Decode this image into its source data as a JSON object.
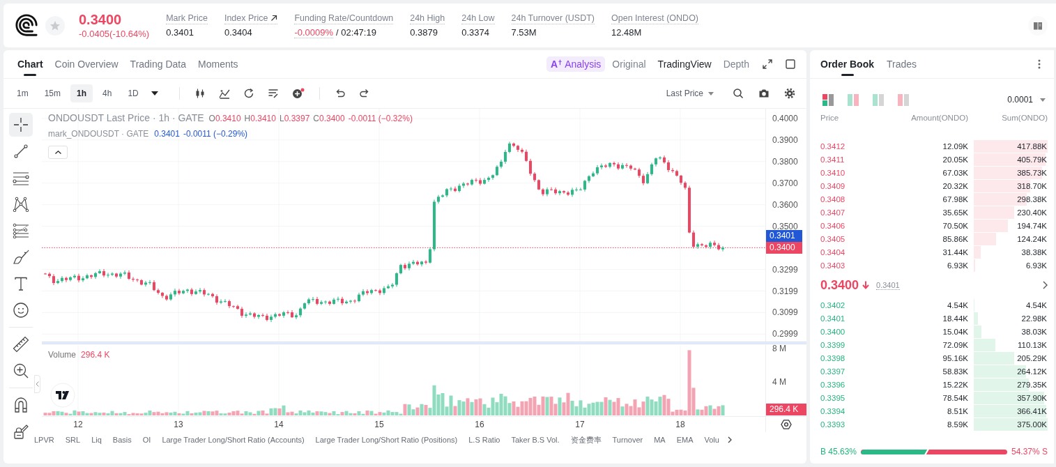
{
  "header": {
    "favorited": false,
    "price": "0.3400",
    "change": "-0.0405(-10.64%)",
    "stats": [
      {
        "kind": "plain",
        "label": "Mark Price",
        "value": "0.3401"
      },
      {
        "kind": "link",
        "label": "Index Price",
        "value": "0.3404"
      },
      {
        "kind": "funding",
        "label": "Funding Rate/Countdown",
        "value": "-0.0009%",
        "countdown": "/ 02:47:19"
      },
      {
        "kind": "plain",
        "label": "24h High",
        "value": "0.3879"
      },
      {
        "kind": "plain",
        "label": "24h Low",
        "value": "0.3374"
      },
      {
        "kind": "plain",
        "label": "24h Turnover (USDT)",
        "value": "7.53M"
      },
      {
        "kind": "plain",
        "label": "Open Interest (ONDO)",
        "value": "12.48M"
      }
    ]
  },
  "chart_panel": {
    "tabs": [
      {
        "label": "Chart",
        "selected": true
      },
      {
        "label": "Coin Overview",
        "selected": false
      },
      {
        "label": "Trading Data",
        "selected": false
      },
      {
        "label": "Moments",
        "selected": false
      }
    ],
    "views": [
      {
        "kind": "ai",
        "badge": "A",
        "label": "Analysis",
        "selected": false
      },
      {
        "kind": "text",
        "label": "Original",
        "selected": false
      },
      {
        "kind": "text",
        "label": "TradingView",
        "selected": true
      },
      {
        "kind": "text",
        "label": "Depth",
        "selected": false
      }
    ],
    "intervals": [
      {
        "label": "1m",
        "selected": false
      },
      {
        "label": "15m",
        "selected": false
      },
      {
        "label": "1h",
        "selected": true
      },
      {
        "label": "4h",
        "selected": false
      },
      {
        "label": "1D",
        "selected": false
      }
    ],
    "price_source": "Last Price",
    "tool_groups": [
      [
        {
          "kind": "crosshair",
          "selected": true
        },
        {
          "kind": "trend_line",
          "selected": false
        },
        {
          "kind": "horizontal_lines",
          "selected": false
        },
        {
          "kind": "pattern",
          "selected": false
        },
        {
          "kind": "fib_lines",
          "selected": false
        },
        {
          "kind": "brush",
          "selected": false
        },
        {
          "kind": "text",
          "selected": false
        },
        {
          "kind": "emoji",
          "selected": false
        }
      ],
      [
        {
          "kind": "ruler",
          "selected": false
        },
        {
          "kind": "zoom_in",
          "selected": false
        }
      ],
      [
        {
          "kind": "magnet",
          "selected": false
        },
        {
          "kind": "lock",
          "selected": false
        }
      ]
    ],
    "legend": {
      "title": "ONDOUSDT Last Price · 1h · GATE",
      "ohlc": [
        {
          "label": "O",
          "value": "0.3410"
        },
        {
          "label": "H",
          "value": "0.3410"
        },
        {
          "label": "L",
          "value": "0.3397"
        },
        {
          "label": "C",
          "value": "0.3400"
        }
      ],
      "change": "-0.0011 (−0.32%)"
    },
    "mark_legend": {
      "title": "mark_ONDOUSDT · GATE",
      "value": "0.3401",
      "change": "-0.0011 (−0.29%)"
    },
    "price_axis": [
      "0.4000",
      "0.3900",
      "0.3800",
      "0.3700",
      "0.3600",
      "0.3500",
      "0.3299",
      "0.3199",
      "0.3099",
      "0.2999"
    ],
    "price_tags": [
      {
        "kind": "mark",
        "value": "0.3401"
      },
      {
        "kind": "last",
        "value": "0.3400"
      }
    ],
    "volume": {
      "title": "Volume",
      "value": "296.4 K",
      "axis": [
        "8 M",
        "4 M"
      ],
      "tag": "296.4 K"
    },
    "time_axis": [
      "12",
      "13",
      "14",
      "15",
      "16",
      "17",
      "18"
    ],
    "indicators": [
      "LPVR",
      "SRL",
      "Liq",
      "Basis",
      "OI",
      "Large Trader Long/Short Ratio (Accounts)",
      "Large Trader Long/Short Ratio (Positions)",
      "L.S Ratio",
      "Taker B.S Vol.",
      "资金费率",
      "Turnover",
      "MA",
      "EMA",
      "Volu"
    ]
  },
  "order_book": {
    "tabs": [
      {
        "label": "Order Book",
        "selected": true
      },
      {
        "label": "Trades",
        "selected": false
      }
    ],
    "layouts": [
      {
        "kind": "both_stacked",
        "selected": true
      },
      {
        "kind": "both_side",
        "selected": false
      },
      {
        "kind": "bids",
        "selected": false
      },
      {
        "kind": "asks",
        "selected": false
      }
    ],
    "precision": "0.0001",
    "columns": [
      "Price",
      "Amount(ONDO)",
      "Sum(ONDO)"
    ],
    "asks": [
      {
        "price": "0.3412",
        "amount": "12.09K",
        "sum": "417.88K"
      },
      {
        "price": "0.3411",
        "amount": "20.05K",
        "sum": "405.79K"
      },
      {
        "price": "0.3410",
        "amount": "67.03K",
        "sum": "385.73K"
      },
      {
        "price": "0.3409",
        "amount": "20.32K",
        "sum": "318.70K"
      },
      {
        "price": "0.3408",
        "amount": "67.98K",
        "sum": "298.38K"
      },
      {
        "price": "0.3407",
        "amount": "35.65K",
        "sum": "230.40K"
      },
      {
        "price": "0.3406",
        "amount": "70.50K",
        "sum": "194.74K"
      },
      {
        "price": "0.3405",
        "amount": "85.86K",
        "sum": "124.24K"
      },
      {
        "price": "0.3404",
        "amount": "31.44K",
        "sum": "38.38K"
      },
      {
        "price": "0.3403",
        "amount": "6.93K",
        "sum": "6.93K"
      }
    ],
    "mid": {
      "price": "0.3400",
      "falling": true,
      "mark": "0.3401"
    },
    "bids": [
      {
        "price": "0.3402",
        "amount": "4.54K",
        "sum": "4.54K"
      },
      {
        "price": "0.3401",
        "amount": "18.44K",
        "sum": "22.98K"
      },
      {
        "price": "0.3400",
        "amount": "15.04K",
        "sum": "38.03K"
      },
      {
        "price": "0.3399",
        "amount": "72.09K",
        "sum": "110.13K"
      },
      {
        "price": "0.3398",
        "amount": "95.16K",
        "sum": "205.29K"
      },
      {
        "price": "0.3397",
        "amount": "58.83K",
        "sum": "264.12K"
      },
      {
        "price": "0.3396",
        "amount": "15.22K",
        "sum": "279.35K"
      },
      {
        "price": "0.3395",
        "amount": "78.54K",
        "sum": "357.90K"
      },
      {
        "price": "0.3394",
        "amount": "8.51K",
        "sum": "366.41K"
      },
      {
        "price": "0.3393",
        "amount": "8.59K",
        "sum": "375.00K"
      }
    ],
    "ratio": {
      "buy_label": "B",
      "buy": "45.63%",
      "sell": "54.37%",
      "sell_label": "S",
      "level": 0.4563
    }
  }
}
